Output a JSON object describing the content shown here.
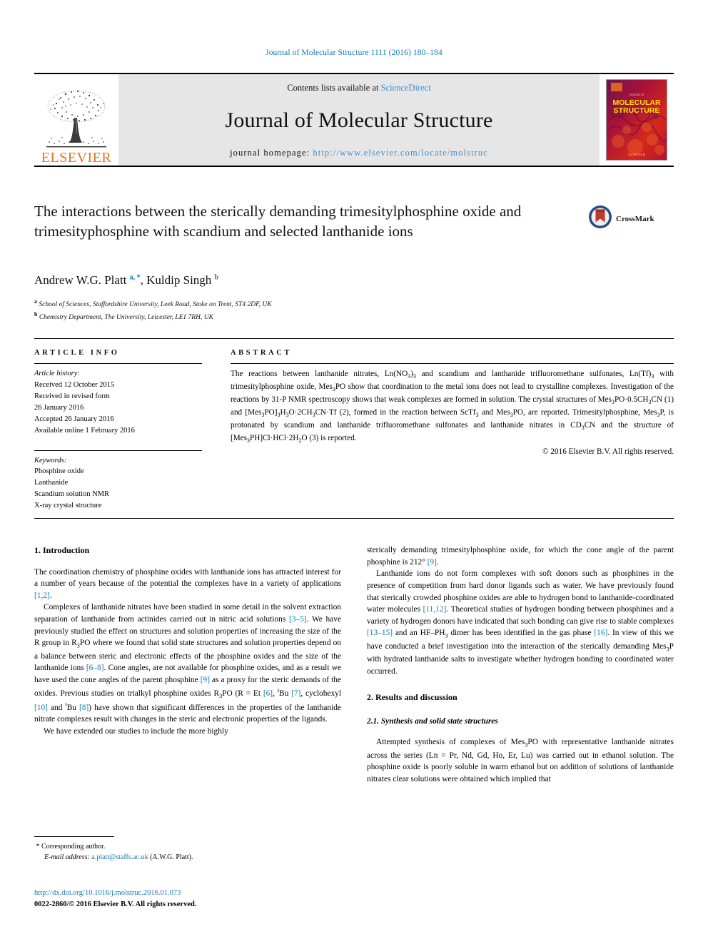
{
  "running_head": "Journal of Molecular Structure 1111 (2016) 180–184",
  "masthead": {
    "contents_prefix": "Contents lists available at ",
    "sciencedirect": "ScienceDirect",
    "journal_name": "Journal of Molecular Structure",
    "homepage_prefix": "journal homepage: ",
    "homepage_url": "http://www.elsevier.com/locate/molstruc",
    "publisher": "ELSEVIER",
    "cover_title_line1": "MOLECULAR",
    "cover_title_line2": "STRUCTURE",
    "cover_kicker": "Journal of",
    "cover_footer": "ELSEVIER"
  },
  "crossmark": {
    "label": "CrossMark"
  },
  "article": {
    "title": "The interactions between the sterically demanding trimesitylphosphine oxide and trimesityphosphine with scandium and selected lanthanide ions",
    "authors_html": "Andrew W.G. Platt <sup>a, *</sup>, Kuldip Singh <sup>b</sup>",
    "affiliation_a": "School of Sciences, Staffordshire University, Leek Road, Stoke on Trent, ST4 2DF, UK",
    "affiliation_b": "Chemistry Department, The University, Leicester, LE1 7RH, UK"
  },
  "article_info": {
    "heading": "ARTICLE INFO",
    "history_label": "Article history:",
    "history": [
      "Received 12 October 2015",
      "Received in revised form",
      "26 January 2016",
      "Accepted 26 January 2016",
      "Available online 1 February 2016"
    ],
    "keywords_label": "Keywords:",
    "keywords": [
      "Phosphine oxide",
      "Lanthanide",
      "Scandium solution NMR",
      "X-ray crystal structure"
    ]
  },
  "abstract": {
    "heading": "ABSTRACT",
    "body_html": "The reactions between lanthanide nitrates, Ln(NO<sub>3</sub>)<sub>3</sub> and scandium and lanthanide trifluoromethane sulfonates, Ln(Tf)<sub>3</sub> with trimesitylphosphine oxide, Mes<sub>3</sub>PO show that coordination to the metal ions does not lead to crystalline complexes. Investigation of the reactions by 31-P NMR spectroscopy shows that weak complexes are formed in solution. The crystal structures of Mes<sub>3</sub>PO·0.5CH<sub>3</sub>CN (1) and [Mes<sub>3</sub>PO]<sub>3</sub>H<sub>3</sub>O·2CH<sub>3</sub>CN·Tf (2), formed in the reaction between ScTf<sub>3</sub> and Mes<sub>3</sub>PO, are reported. Trimesitylphosphine, Mes<sub>3</sub>P, is protonated by scandium and lanthanide trifluoromethane sulfonates and lanthanide nitrates in CD<sub>3</sub>CN and the structure of [Mes<sub>3</sub>PH]Cl·HCl·2H<sub>2</sub>O (3) is reported.",
    "copyright": "© 2016 Elsevier B.V. All rights reserved."
  },
  "body": {
    "left": {
      "section1_heading": "1. Introduction",
      "p1_html": "The coordination chemistry of phosphine oxides with lanthanide ions has attracted interest for a number of years because of the potential the complexes have in a variety of applications <span class=\"ref\">[1,2]</span>.",
      "p2_html": "Complexes of lanthanide nitrates have been studied in some detail in the solvent extraction separation of lanthanide from actinides carried out in nitric acid solutions <span class=\"ref\">[3–5]</span>. We have previously studied the effect on structures and solution properties of increasing the size of the R group in R<sub>3</sub>PO where we found that solid state structures and solution properties depend on a balance between steric and electronic effects of the phosphine oxides and the size of the lanthanide ions <span class=\"ref\">[6–8]</span>. Cone angles, are not available for phosphine oxides, and as a result we have used the cone angles of the parent phosphine <span class=\"ref\">[9]</span> as a proxy for the steric demands of the oxides. Previous studies on trialkyl phosphine oxides R<sub>3</sub>PO (R = Et <span class=\"ref\">[6]</span>, <sup>i</sup>Bu <span class=\"ref\">[7]</span>, cyclohexyl <span class=\"ref\">[10]</span> and <sup>t</sup>Bu <span class=\"ref\">[8]</span>) have shown that significant differences in the properties of the lanthanide nitrate complexes result with changes in the steric and electronic properties of the ligands.",
      "p3_html": "We have extended our studies to include the more highly"
    },
    "right": {
      "p1_html": "sterically demanding trimesitylphosphine oxide, for which the cone angle of the parent phosphine is 212° <span class=\"ref\">[9]</span>.",
      "p2_html": "Lanthanide ions do not form complexes with soft donors such as phosphines in the presence of competition from hard donor ligands such as water. We have previously found that sterically crowded phosphine oxides are able to hydrogen bond to lanthanide-coordinated water molecules <span class=\"ref\">[11,12]</span>. Theoretical studies of hydrogen bonding between phosphines and a variety of hydrogen donors have indicated that such bonding can give rise to stable complexes <span class=\"ref\">[13–15]</span> and an HF–PH<sub>3</sub> dimer has been identified in the gas phase <span class=\"ref\">[16]</span>. In view of this we have conducted a brief investigation into the interaction of the sterically demanding Mes<sub>3</sub>P with hydrated lanthanide salts to investigate whether hydrogen bonding to coordinated water occurred.",
      "section2_heading": "2. Results and discussion",
      "subsection21_heading": "2.1. Synthesis and solid state structures",
      "p3_html": "Attempted synthesis of complexes of Mes<sub>3</sub>PO with representative lanthanide nitrates across the series (Ln = Pr, Nd, Gd, Ho, Er, Lu) was carried out in ethanol solution. The phosphine oxide is poorly soluble in warm ethanol but on addition of solutions of lanthanide nitrates clear solutions were obtained which implied that"
    }
  },
  "footnote": {
    "corresponding_marker": "*",
    "corresponding_text": "Corresponding author.",
    "email_label": "E-mail address:",
    "email": "a.platt@staffs.ac.uk",
    "email_owner": "(A.W.G. Platt)."
  },
  "footer": {
    "doi": "http://dx.doi.org/10.1016/j.molstruc.2016.01.073",
    "issn_line": "0022-2860/© 2016 Elsevier B.V. All rights reserved."
  },
  "colors": {
    "link": "#1178b4",
    "elsevier_orange": "#e9711c",
    "masthead_grey": "#e6e6e6",
    "crossmark_blue": "#2b4a7d",
    "crossmark_red": "#c0392b"
  }
}
